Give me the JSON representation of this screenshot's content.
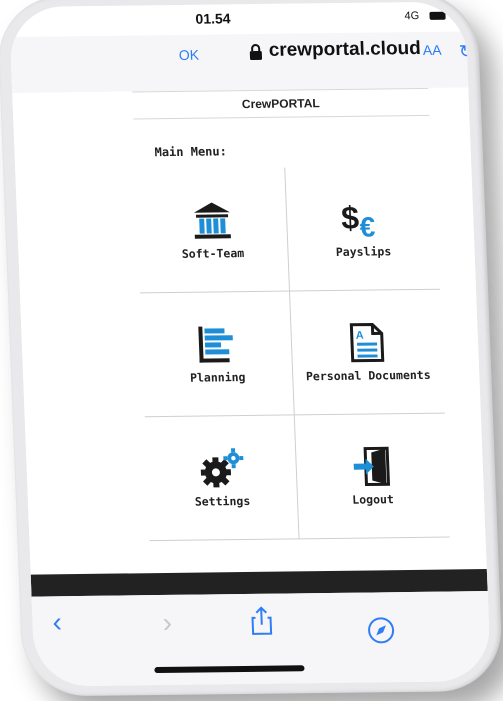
{
  "statusbar": {
    "time": "01.54",
    "network": "4G"
  },
  "browser": {
    "ok_label": "OK",
    "domain": "crewportal.cloud",
    "text_size_label": "AA"
  },
  "portal": {
    "title": "CrewPORTAL",
    "menu_heading": "Main Menu:"
  },
  "menu": {
    "items": [
      {
        "label": "Soft-Team",
        "icon": "building-icon"
      },
      {
        "label": "Payslips",
        "icon": "money-icon"
      },
      {
        "label": "Planning",
        "icon": "gantt-icon"
      },
      {
        "label": "Personal Documents",
        "icon": "document-icon"
      },
      {
        "label": "Settings",
        "icon": "gears-icon"
      },
      {
        "label": "Logout",
        "icon": "exit-door-icon"
      }
    ]
  },
  "colors": {
    "accent": "#2f7df6",
    "icon_blue": "#1e8fd6",
    "icon_dark": "#1a1a1a"
  }
}
